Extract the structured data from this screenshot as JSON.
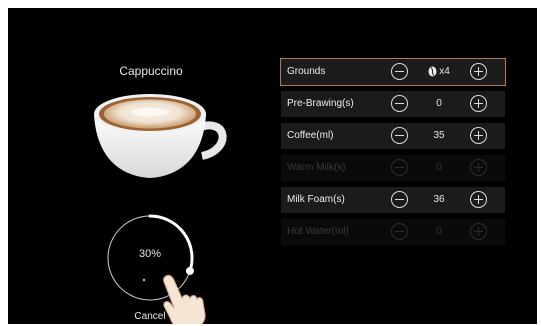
{
  "drink": {
    "name": "Cappuccino"
  },
  "progress": {
    "percent_label": "30%",
    "value_percent": 30
  },
  "cancel_label": "Cancel",
  "settings": [
    {
      "label": "Grounds",
      "value": "x4",
      "icon": "coffee-bean-icon",
      "state": "selected"
    },
    {
      "label": "Pre-Brawing(s)",
      "value": "0",
      "state": "enabled"
    },
    {
      "label": "Coffee(ml)",
      "value": "35",
      "state": "enabled"
    },
    {
      "label": "Warm Milk(s)",
      "value": "0",
      "state": "disabled"
    },
    {
      "label": "Milk Foam(s)",
      "value": "36",
      "state": "enabled"
    },
    {
      "label": "Hot Water(ml)",
      "value": "0",
      "state": "disabled"
    }
  ],
  "colors": {
    "background": "#000000",
    "selected_border": "#b0775a",
    "row_bg": "#1b1b1b"
  }
}
